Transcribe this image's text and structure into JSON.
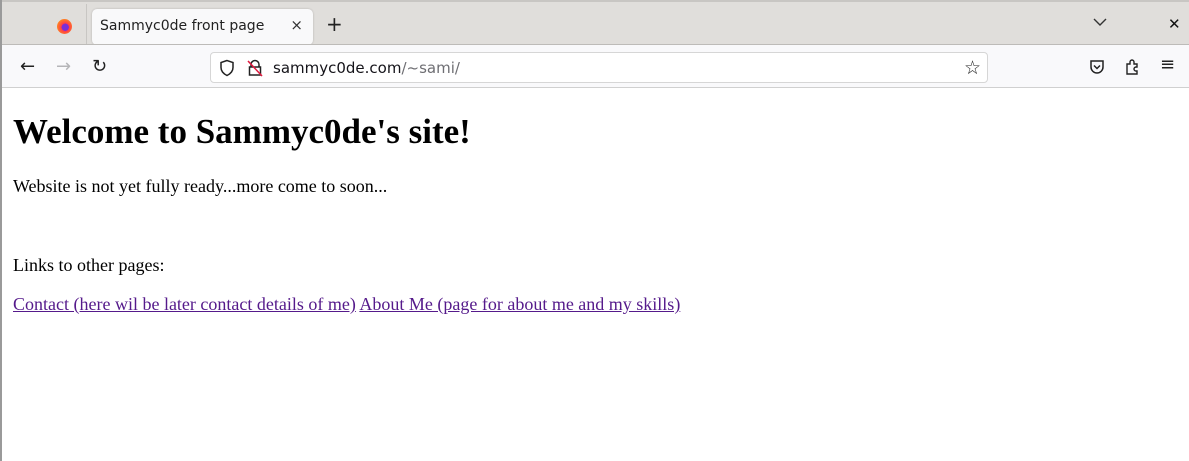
{
  "browser": {
    "tab": {
      "title": "Sammyc0de front page",
      "close": "×"
    },
    "new_tab": "+",
    "tabs_list": "⌄",
    "window_close": "✕",
    "nav": {
      "back": "←",
      "forward": "→",
      "reload": "↻"
    },
    "url": {
      "host": "sammyc0de.com",
      "path": "/~sami/"
    },
    "icons": {
      "shield": "🛡",
      "bookmark": "☆",
      "pocket": "pocket-icon",
      "extensions": "puzzle-icon",
      "menu": "≡"
    }
  },
  "page": {
    "heading": "Welcome to Sammyc0de's site!",
    "notice": "Website is not yet fully ready...more come to soon...",
    "links_label": "Links to other pages:",
    "links": [
      {
        "label": "Contact (here wil be later contact details of me)"
      },
      {
        "label": "About Me (page for about me and my skills)"
      }
    ],
    "link_color": "#551a8b"
  }
}
